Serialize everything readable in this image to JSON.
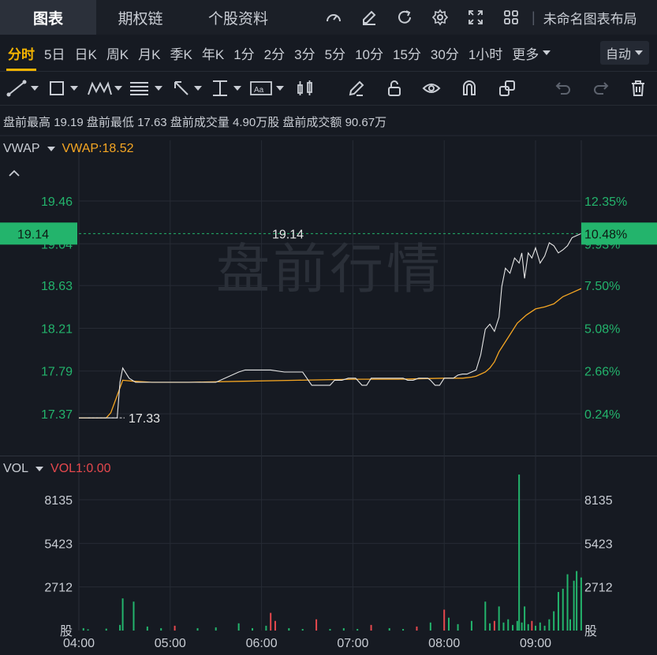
{
  "top_tabs": [
    {
      "label": "图表",
      "active": true
    },
    {
      "label": "期权链",
      "active": false
    },
    {
      "label": "个股资料",
      "active": false
    }
  ],
  "layout_name": "未命名图表布局",
  "periods": [
    "分时",
    "5日",
    "日K",
    "周K",
    "月K",
    "季K",
    "年K",
    "1分",
    "2分",
    "3分",
    "5分",
    "10分",
    "15分",
    "30分",
    "1小时",
    "更多"
  ],
  "active_period": "分时",
  "auto_label": "自动",
  "premarket_info": {
    "high_label": "盘前最高",
    "high": "19.19",
    "low_label": "盘前最低",
    "low": "17.63",
    "vol_label": "盘前成交量",
    "vol": "4.90万股",
    "amt_label": "盘前成交额",
    "amt": "90.67万"
  },
  "indicator_main": {
    "name": "VWAP",
    "value_label": "VWAP:18.52"
  },
  "indicator_vol": {
    "name": "VOL",
    "value_label": "VOL1:0.00"
  },
  "watermark": "盘前行情",
  "current_price_label": "19.14",
  "current_pct_label": "10.48%",
  "price_peak_annotation": "19.14",
  "price_low_annotation": "17.33",
  "colors": {
    "up": "#23b46c",
    "down": "#e5484d",
    "vwap": "#f5a623",
    "price": "#e6e6e6",
    "accent": "#f5b400"
  },
  "chart_data": {
    "type": "line",
    "x_ticks": [
      "04:00",
      "05:00",
      "06:00",
      "07:00",
      "08:00",
      "09:00"
    ],
    "y_left_ticks": [
      "19.46",
      "19.04",
      "18.63",
      "18.21",
      "17.79",
      "17.37"
    ],
    "y_right_ticks": [
      "12.35%",
      "9.93%",
      "7.50%",
      "5.08%",
      "2.66%",
      "0.24%"
    ],
    "ylim": [
      17.05,
      19.6
    ],
    "vol_ticks": [
      "8135",
      "5423",
      "2712"
    ],
    "vol_unit": "股",
    "vol_ylim": [
      0,
      10300
    ],
    "series": [
      {
        "name": "price",
        "x": [
          0,
          0.35,
          0.42,
          0.45,
          0.48,
          0.55,
          0.62,
          0.75,
          1.0,
          1.2,
          1.5,
          1.75,
          1.82,
          1.9,
          2.1,
          2.25,
          2.45,
          2.55,
          2.75,
          2.8,
          2.88,
          2.95,
          3.03,
          3.1,
          3.15,
          3.2,
          3.25,
          3.3,
          3.35,
          3.4,
          3.45,
          3.5,
          3.55,
          3.6,
          3.66,
          3.72,
          3.78,
          3.82,
          3.85,
          3.9,
          3.95,
          4.0,
          4.05,
          4.1,
          4.15,
          4.2,
          4.25,
          4.3,
          4.35,
          4.4,
          4.45,
          4.5,
          4.55,
          4.6,
          4.63,
          4.67,
          4.72,
          4.77,
          4.82,
          4.85,
          4.88,
          4.92,
          4.96,
          5.0,
          5.05,
          5.1,
          5.15,
          5.2,
          5.25,
          5.3,
          5.35,
          5.4,
          5.45,
          5.5
        ],
        "y": [
          17.33,
          17.33,
          17.33,
          17.68,
          17.82,
          17.72,
          17.68,
          17.68,
          17.68,
          17.68,
          17.68,
          17.78,
          17.8,
          17.8,
          17.8,
          17.78,
          17.78,
          17.65,
          17.65,
          17.7,
          17.7,
          17.72,
          17.72,
          17.65,
          17.65,
          17.72,
          17.72,
          17.72,
          17.72,
          17.72,
          17.72,
          17.72,
          17.72,
          17.7,
          17.7,
          17.72,
          17.72,
          17.72,
          17.7,
          17.65,
          17.65,
          17.72,
          17.72,
          17.72,
          17.75,
          17.76,
          17.76,
          17.78,
          17.8,
          17.95,
          18.2,
          18.25,
          18.18,
          18.32,
          18.62,
          18.8,
          18.75,
          18.9,
          18.85,
          18.95,
          18.7,
          18.95,
          18.9,
          19.0,
          18.85,
          18.92,
          19.05,
          19.02,
          18.95,
          18.98,
          19.02,
          19.1,
          19.12,
          19.14
        ]
      },
      {
        "name": "vwap",
        "x": [
          0,
          0.3,
          0.35,
          0.42,
          0.48,
          0.6,
          0.8,
          1.2,
          1.8,
          2.4,
          3.0,
          3.5,
          4.0,
          4.2,
          4.3,
          4.35,
          4.4,
          4.45,
          4.5,
          4.55,
          4.6,
          4.7,
          4.8,
          4.9,
          5.0,
          5.1,
          5.2,
          5.3,
          5.4,
          5.5
        ],
        "y": [
          17.33,
          17.33,
          17.38,
          17.55,
          17.7,
          17.69,
          17.68,
          17.68,
          17.69,
          17.7,
          17.71,
          17.71,
          17.72,
          17.72,
          17.73,
          17.74,
          17.76,
          17.78,
          17.82,
          17.88,
          17.98,
          18.12,
          18.26,
          18.34,
          18.4,
          18.42,
          18.45,
          18.52,
          18.56,
          18.6
        ]
      },
      {
        "name": "volume",
        "x": [
          0.05,
          0.1,
          0.3,
          0.45,
          0.48,
          0.6,
          0.75,
          0.9,
          1.05,
          1.3,
          1.5,
          1.75,
          1.9,
          2.05,
          2.1,
          2.15,
          2.3,
          2.45,
          2.6,
          2.75,
          2.9,
          3.05,
          3.2,
          3.4,
          3.55,
          3.7,
          3.85,
          4.0,
          4.05,
          4.15,
          4.3,
          4.45,
          4.5,
          4.55,
          4.6,
          4.65,
          4.7,
          4.75,
          4.8,
          4.82,
          4.85,
          4.88,
          4.92,
          4.96,
          5.0,
          5.05,
          5.1,
          5.15,
          5.2,
          5.25,
          5.3,
          5.35,
          5.38,
          5.42,
          5.45,
          5.5
        ],
        "y": [
          150,
          80,
          120,
          350,
          2000,
          1800,
          250,
          150,
          300,
          150,
          200,
          450,
          150,
          300,
          1100,
          600,
          150,
          100,
          700,
          100,
          150,
          100,
          350,
          150,
          100,
          250,
          500,
          1300,
          800,
          400,
          600,
          1800,
          450,
          600,
          1500,
          500,
          700,
          350,
          600,
          9700,
          500,
          1500,
          400,
          600,
          300,
          500,
          300,
          700,
          1200,
          2400,
          2600,
          3500,
          700,
          3100,
          3700,
          3300
        ],
        "colors": [
          "up",
          "up",
          "up",
          "up",
          "up",
          "up",
          "up",
          "up",
          "down",
          "up",
          "up",
          "up",
          "up",
          "up",
          "down",
          "down",
          "up",
          "up",
          "down",
          "up",
          "up",
          "up",
          "down",
          "up",
          "up",
          "down",
          "up",
          "down",
          "up",
          "up",
          "up",
          "up",
          "up",
          "down",
          "up",
          "up",
          "up",
          "up",
          "up",
          "up",
          "up",
          "up",
          "up",
          "down",
          "up",
          "up",
          "up",
          "up",
          "up",
          "up",
          "up",
          "up",
          "up",
          "up",
          "up",
          "up"
        ]
      }
    ]
  }
}
